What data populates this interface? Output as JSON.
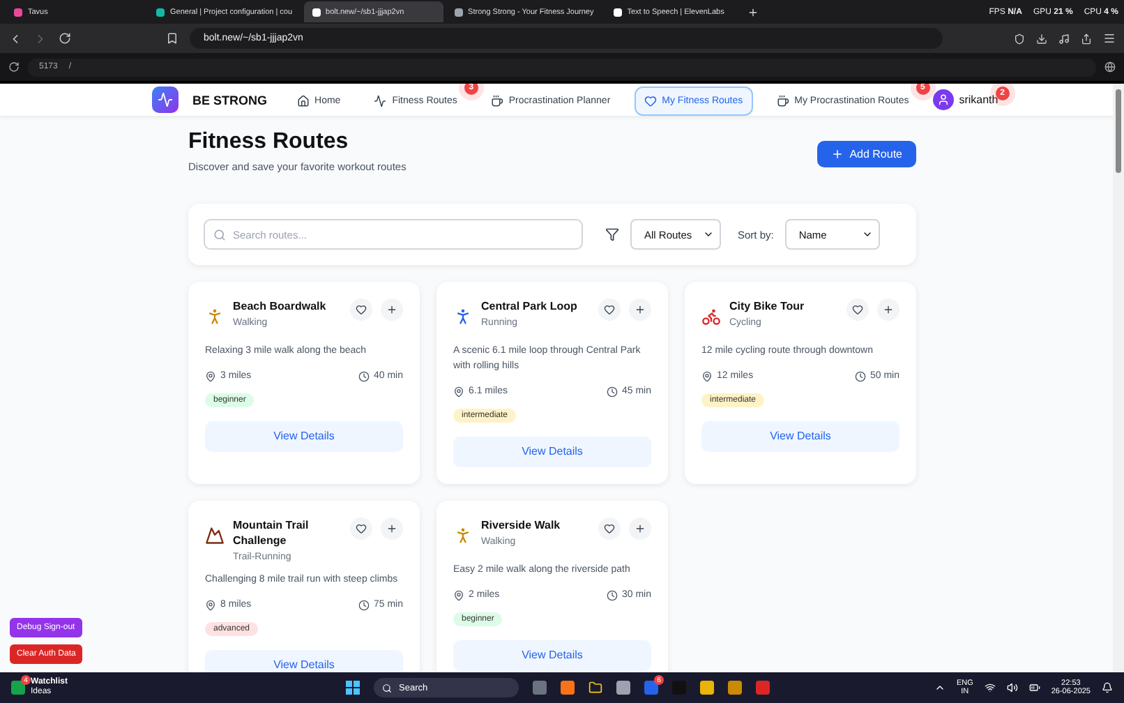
{
  "browser": {
    "tabs": [
      {
        "label": "Tavus",
        "selected": false
      },
      {
        "label": "General | Project configuration | cou",
        "selected": false
      },
      {
        "label": "bolt.new/~/sb1-jjjap2vn",
        "selected": true
      },
      {
        "label": "Strong Strong - Your Fitness Journey",
        "selected": false
      },
      {
        "label": "Text to Speech | ElevenLabs",
        "selected": false
      }
    ],
    "stats": [
      {
        "label": "FPS",
        "value": "N/A"
      },
      {
        "label": "GPU",
        "value": "21 %"
      },
      {
        "label": "CPU",
        "value": "4 %"
      }
    ],
    "address": "bolt.new/~/sb1-jjjap2vn",
    "port": "5173",
    "path": "/"
  },
  "app": {
    "brand": "BE STRONG",
    "nav": [
      {
        "label": "Home",
        "kind": "home",
        "selected": false
      },
      {
        "label": "Fitness Routes",
        "kind": "activity",
        "selected": false,
        "badge": "3"
      },
      {
        "label": "Procrastination Planner",
        "kind": "cup",
        "selected": false
      },
      {
        "label": "My Fitness Routes",
        "kind": "heart",
        "selected": true
      },
      {
        "label": "My Procrastination Routes",
        "kind": "cup",
        "selected": false,
        "badge": "5"
      }
    ],
    "user": {
      "name": "srikanth",
      "badge": "2"
    },
    "title": "Fitness Routes",
    "subtitle": "Discover and save your favorite workout routes",
    "add_button": "Add Route",
    "search": {
      "placeholder": "Search routes..."
    },
    "filter": "All Routes",
    "sort_label": "Sort by:",
    "sort": "Name",
    "routes": [
      {
        "name": "Beach Boardwalk",
        "type": "Walking",
        "kind": "walk",
        "description": "Relaxing 3 mile walk along the beach",
        "distance": "3 miles",
        "time": "40 min",
        "tag": {
          "label": "beginner",
          "color": "#dcfce7"
        },
        "button": "View Details"
      },
      {
        "name": "Central Park Loop",
        "type": "Running",
        "kind": "run",
        "description": "A scenic 6.1 mile loop through Central Park with rolling hills",
        "distance": "6.1 miles",
        "time": "45 min",
        "tag": {
          "label": "intermediate",
          "color": "#fef3c7"
        },
        "button": "View Details"
      },
      {
        "name": "City Bike Tour",
        "type": "Cycling",
        "kind": "bike",
        "description": "12 mile cycling route through downtown",
        "distance": "12 miles",
        "time": "50 min",
        "tag": {
          "label": "intermediate",
          "color": "#fef3c7"
        },
        "button": "View Details"
      },
      {
        "name": "Mountain Trail Challenge",
        "type": "Trail-Running",
        "kind": "trail",
        "description": "Challenging 8 mile trail run with steep climbs",
        "distance": "8 miles",
        "time": "75 min",
        "tag": {
          "label": "advanced",
          "color": "#fee2e2"
        },
        "button": "View Details"
      },
      {
        "name": "Riverside Walk",
        "type": "Walking",
        "kind": "walk",
        "description": "Easy 2 mile walk along the riverside path",
        "distance": "2 miles",
        "time": "30 min",
        "tag": {
          "label": "beginner",
          "color": "#dcfce7"
        },
        "button": "View Details"
      }
    ],
    "debug_buttons": [
      {
        "label": "Debug Sign-out",
        "color": "#9333ea"
      },
      {
        "label": "Clear Auth Data",
        "color": "#dc2626"
      }
    ]
  },
  "taskbar": {
    "widget": {
      "title": "Watchlist",
      "subtitle": "Ideas",
      "badge": "4"
    },
    "search": "Search",
    "app_badge": "6",
    "lang": "ENG",
    "region": "IN",
    "time": "22:53",
    "date": "26-06-2025"
  }
}
